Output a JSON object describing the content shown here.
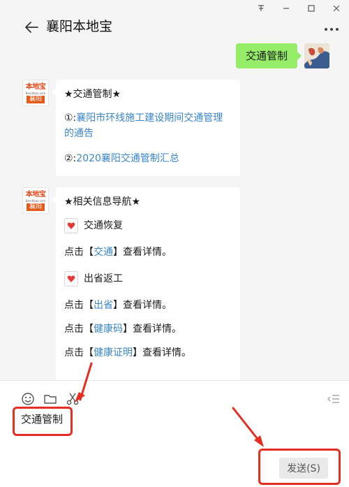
{
  "window_controls": [
    "pin-icon",
    "minimize-icon",
    "maximize-icon",
    "close-icon"
  ],
  "header": {
    "title": "襄阳本地宝"
  },
  "messages": {
    "outgoing": "交通管制",
    "bot_avatar": {
      "top": "本地宝",
      "domain": "Bendibao.com",
      "city": "襄阳"
    },
    "msg1": {
      "title": "★交通管制★",
      "item1_prefix": "①:",
      "item1_link": "襄阳市环线施工建设期间交通管理的通告",
      "item2_prefix": "②:",
      "item2_link": "2020襄阳交通管制汇总"
    },
    "msg2": {
      "title": "★相关信息导航★",
      "s1_heading": "交通恢复",
      "s1_pre": "点击【",
      "s1_link": "交通",
      "s1_post": "】查看详情。",
      "s2_heading": "出省返工",
      "s2_pre": "点击【",
      "s2_link": "出省",
      "s2_post": "】查看详情。",
      "s3_pre": "点击【",
      "s3_link": "健康码",
      "s3_post": "】查看详情。",
      "s4_pre": "点击【",
      "s4_link": "健康证明",
      "s4_post": "】查看详情。"
    }
  },
  "input": {
    "value": "交通管制",
    "send_label": "发送(S)"
  },
  "colors": {
    "outgoing_bubble": "#95ec69",
    "link": "#3a86c8",
    "highlight": "#e52d21"
  }
}
